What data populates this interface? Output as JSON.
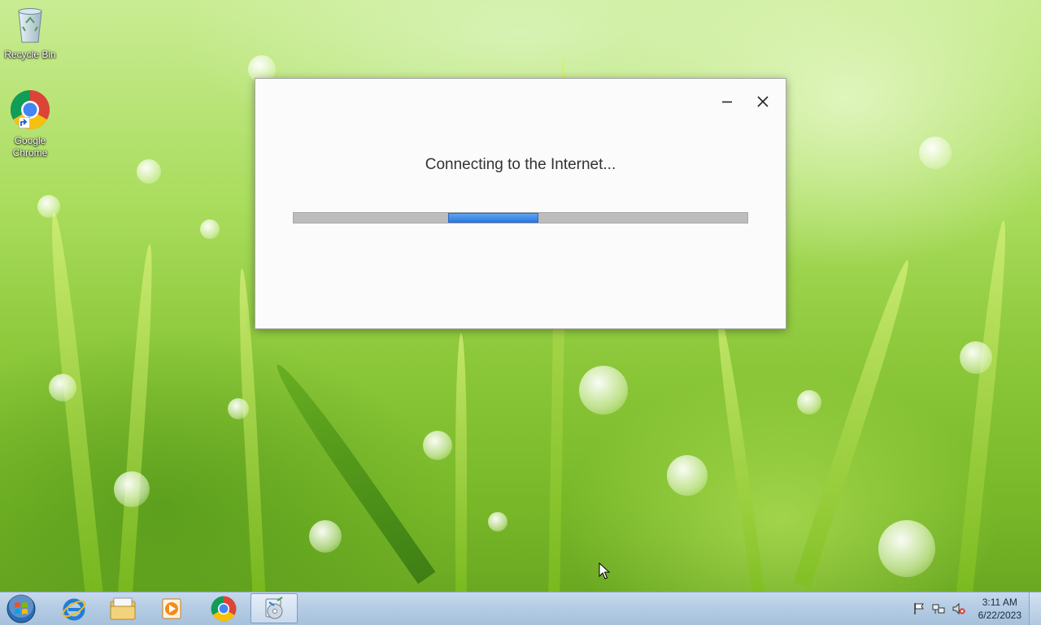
{
  "desktop": {
    "icons": [
      {
        "label": "Recycle Bin",
        "icon": "recycle-bin-icon"
      },
      {
        "label": "Google Chrome",
        "icon": "chrome-icon"
      }
    ]
  },
  "dialog": {
    "message": "Connecting to the Internet...",
    "minimize_icon": "minimize-icon",
    "close_icon": "close-icon",
    "progress": {
      "mode": "indeterminate",
      "segment_start": 0.34,
      "segment_end": 0.54,
      "fill_color": "#3b86e8"
    }
  },
  "taskbar": {
    "start_icon": "windows-start-icon",
    "pinned": [
      {
        "icon": "internet-explorer-icon"
      },
      {
        "icon": "file-explorer-icon"
      },
      {
        "icon": "media-player-icon"
      },
      {
        "icon": "chrome-icon"
      },
      {
        "icon": "installer-icon",
        "active": true
      }
    ],
    "tray_icons": [
      "action-center-flag-icon",
      "network-icon",
      "volume-muted-icon"
    ],
    "clock": {
      "time": "3:11 AM",
      "date": "6/22/2023"
    }
  }
}
